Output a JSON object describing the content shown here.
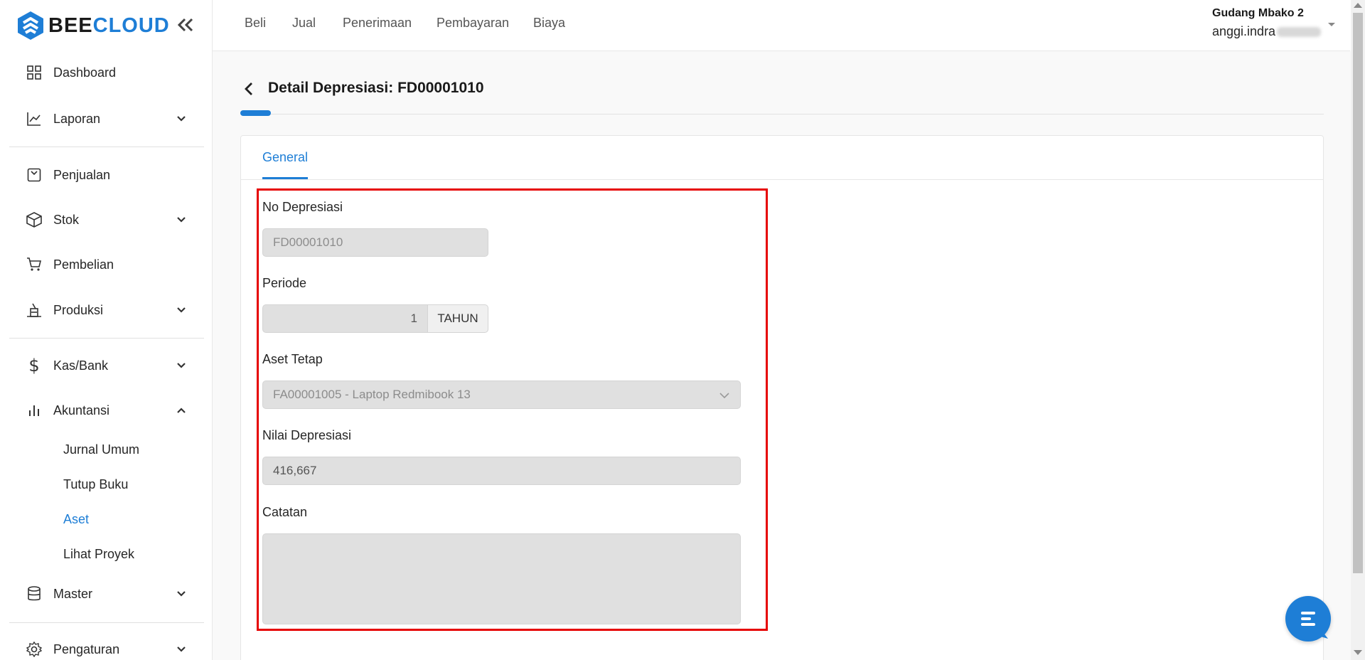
{
  "brand": {
    "part1": "BEE",
    "part2": "CLOUD"
  },
  "sidebar": {
    "items": [
      {
        "label": "Dashboard",
        "icon": "dashboard-icon"
      },
      {
        "label": "Laporan",
        "icon": "chart-line-icon"
      },
      {
        "label": "Penjualan",
        "icon": "receipt-icon"
      },
      {
        "label": "Stok",
        "icon": "box-icon"
      },
      {
        "label": "Pembelian",
        "icon": "cart-icon"
      },
      {
        "label": "Produksi",
        "icon": "factory-icon"
      },
      {
        "label": "Kas/Bank",
        "icon": "dollar-icon"
      },
      {
        "label": "Akuntansi",
        "icon": "bar-chart-icon"
      },
      {
        "label": "Master",
        "icon": "database-icon"
      },
      {
        "label": "Pengaturan",
        "icon": "gear-icon"
      }
    ],
    "akuntansi_sub": [
      "Jurnal Umum",
      "Tutup Buku",
      "Aset",
      "Lihat Proyek"
    ]
  },
  "topnav": [
    "Beli",
    "Jual",
    "Penerimaan",
    "Pembayaran",
    "Biaya"
  ],
  "user": {
    "company": "Gudang Mbako 2",
    "email_visible": "anggi.indra"
  },
  "page": {
    "title": "Detail Depresiasi: FD00001010"
  },
  "tabs": {
    "general": "General"
  },
  "form": {
    "no_label": "No Depresiasi",
    "no_value": "FD00001010",
    "periode_label": "Periode",
    "periode_value": "1",
    "periode_unit": "TAHUN",
    "aset_label": "Aset Tetap",
    "aset_value": "FA00001005 - Laptop Redmibook 13",
    "nilai_label": "Nilai Depresiasi",
    "nilai_value": "416,667",
    "catatan_label": "Catatan",
    "catatan_value": ""
  },
  "colors": {
    "accent": "#1e7ed6",
    "highlight": "#e60000"
  }
}
